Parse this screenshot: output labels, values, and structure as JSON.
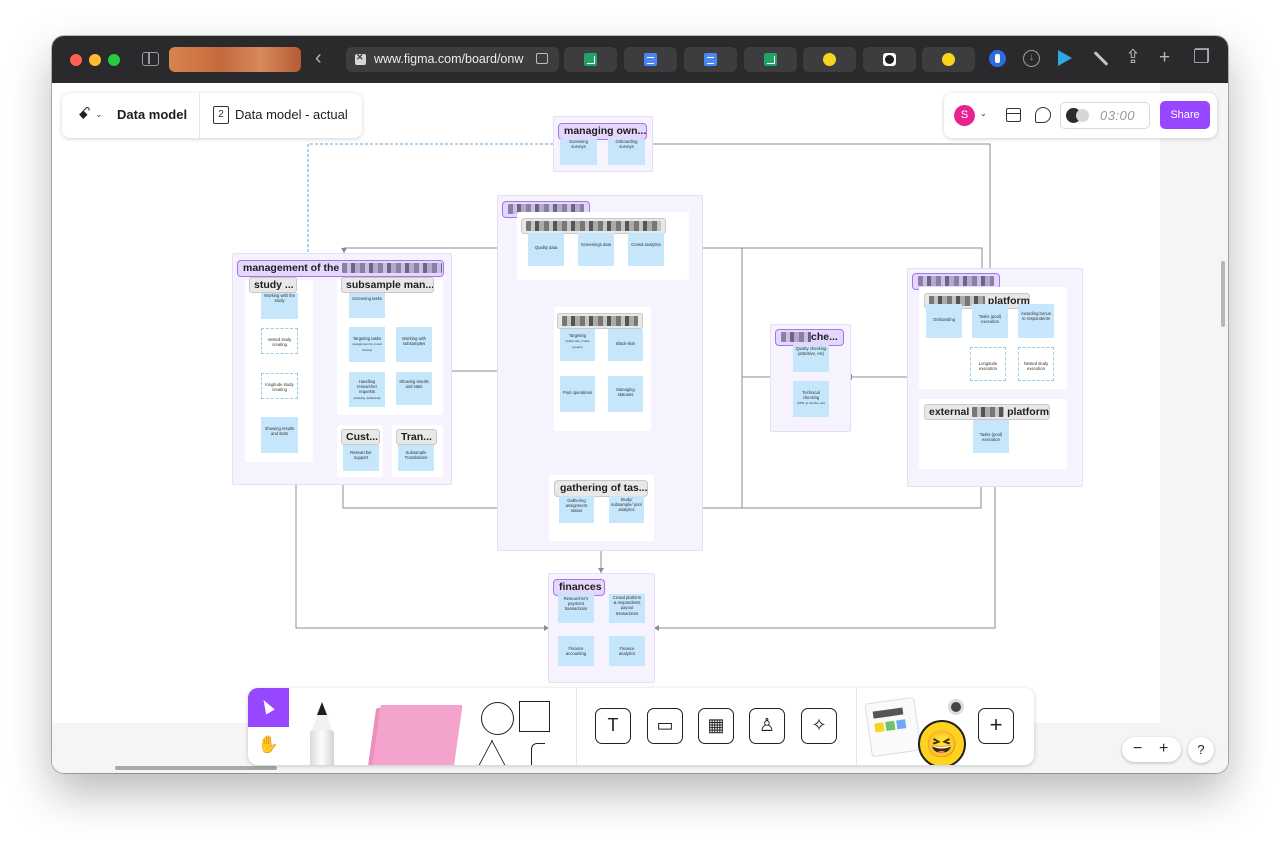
{
  "browser": {
    "url": "www.figma.com/board/onw",
    "pinned_tabs": [
      "sheets-icon",
      "docs-icon",
      "docs-icon",
      "sheets-icon",
      "miro-icon",
      "github-icon",
      "miro-icon"
    ]
  },
  "file": {
    "title": "Data model",
    "page_number": "2",
    "page_name": "Data model - actual"
  },
  "collab": {
    "avatar_initial": "S",
    "timer": "03:00",
    "share_label": "Share"
  },
  "board": {
    "managing_owners": {
      "title": "managing own...",
      "stickies": [
        "Screening surveys",
        "Onboarding surveys"
      ]
    },
    "management": {
      "title_prefix": "management of the",
      "study": {
        "title": "study ...",
        "stickies": [
          "Working with the study",
          "nested study creating",
          "longitude study creating",
          "Showing results and stats"
        ]
      },
      "subsample": {
        "title": "subsample man...",
        "stickies": [
          "Screening tasks",
          "Targeting tasks",
          "Working with subsamples",
          "Handling researcher requests",
          "Showing results and stats"
        ],
        "targeting_note": "(assignment by crowd criteria)",
        "handling_note": "(cashing, additional)"
      },
      "customer": {
        "title": "Cust...",
        "sticky": "Researcher support"
      },
      "translations": {
        "title": "Tran...",
        "sticky": "Subsample Translations"
      }
    },
    "center": {
      "data_stickies": [
        "Quality data",
        "Screenings data",
        "Crowd analytics"
      ],
      "pool_stickies": [
        "Targeting",
        "Black-lists",
        "Pool operations",
        "Managing statuses"
      ],
      "targeting_note": "(white lists, crowd groups)"
    },
    "gathering": {
      "title": "gathering of tas...",
      "stickies": [
        "Gathering assignment status",
        "Study/ subsample/ pool analytics"
      ]
    },
    "checks": {
      "title_suffix": "che...",
      "stickies": [
        "Quality checking (attentive, etc)",
        "Technical checking"
      ],
      "technical_note": "(VPN, ip checks, etc)"
    },
    "platform": {
      "inner_title": "platform",
      "stickies": [
        "Onboarding",
        "Tasks (pool) execution",
        "Awarding bonus to respondents",
        "Longitude execution",
        "Nested study execution"
      ]
    },
    "external": {
      "title_prefix": "external",
      "title_suffix": "platform",
      "sticky": "Tasks (pool) execution"
    },
    "finances": {
      "title": "finances",
      "stickies": [
        "Researcher's payment transactions",
        "Crowd platform & respondents payout transactions",
        "Finance accounting",
        "Finance analytics"
      ]
    }
  },
  "toolbar": {
    "tools": [
      "select-tool",
      "hand-tool",
      "marker",
      "sticky-note",
      "shapes",
      "text",
      "section",
      "table",
      "stamp",
      "ai-actions",
      "widgets",
      "add"
    ],
    "text_glyph": "T",
    "add_glyph": "+"
  },
  "zoom": {
    "minus": "−",
    "plus": "+",
    "help": "?"
  },
  "colors": {
    "accent": "#9747ff",
    "section_fill": "#f6f3fe",
    "section_tag": "#e4d6fc",
    "sticky_blue": "#c6e6fb",
    "chrome_bg": "#2a2a2c"
  }
}
